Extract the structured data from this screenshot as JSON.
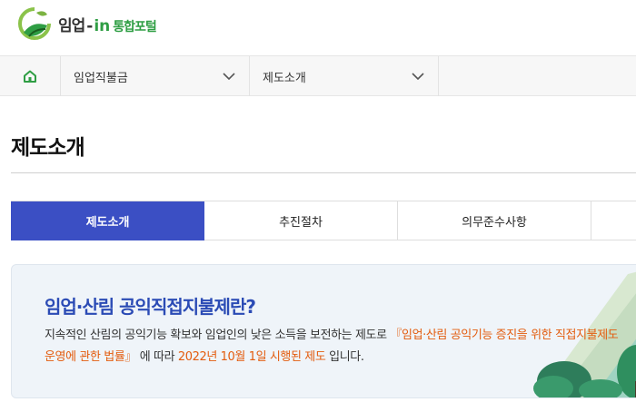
{
  "header": {
    "logo_main": "임업",
    "logo_dash": "-",
    "logo_in": "in",
    "logo_sub": "통합포털"
  },
  "breadcrumb": {
    "home_icon": "home-icon",
    "level1": "임업직불금",
    "level2": "제도소개"
  },
  "page": {
    "title": "제도소개"
  },
  "tabs": [
    {
      "label": "제도소개",
      "active": true
    },
    {
      "label": "추진절차",
      "active": false
    },
    {
      "label": "의무준수사항",
      "active": false
    }
  ],
  "intro": {
    "title": "임업·산림 공익직접지불제란?",
    "text_before": "지속적인 산림의 공익기능 확보와 임업인의 낮은 소득을 보전하는 제도로 ",
    "text_law": "『임업·산림 공익기능 증진을 위한 직접지불제도 운영에 관한 법률』",
    "text_middle": " 에 따라 ",
    "text_date": "2022년 10월 1일 시행된 제도",
    "text_after": " 입니다."
  },
  "colors": {
    "brand_green": "#2f9e44",
    "tab_active": "#3b4fc4",
    "intro_title": "#2b4bb5",
    "highlight": "#e35c0e",
    "intro_bg": "#eff4f9"
  }
}
